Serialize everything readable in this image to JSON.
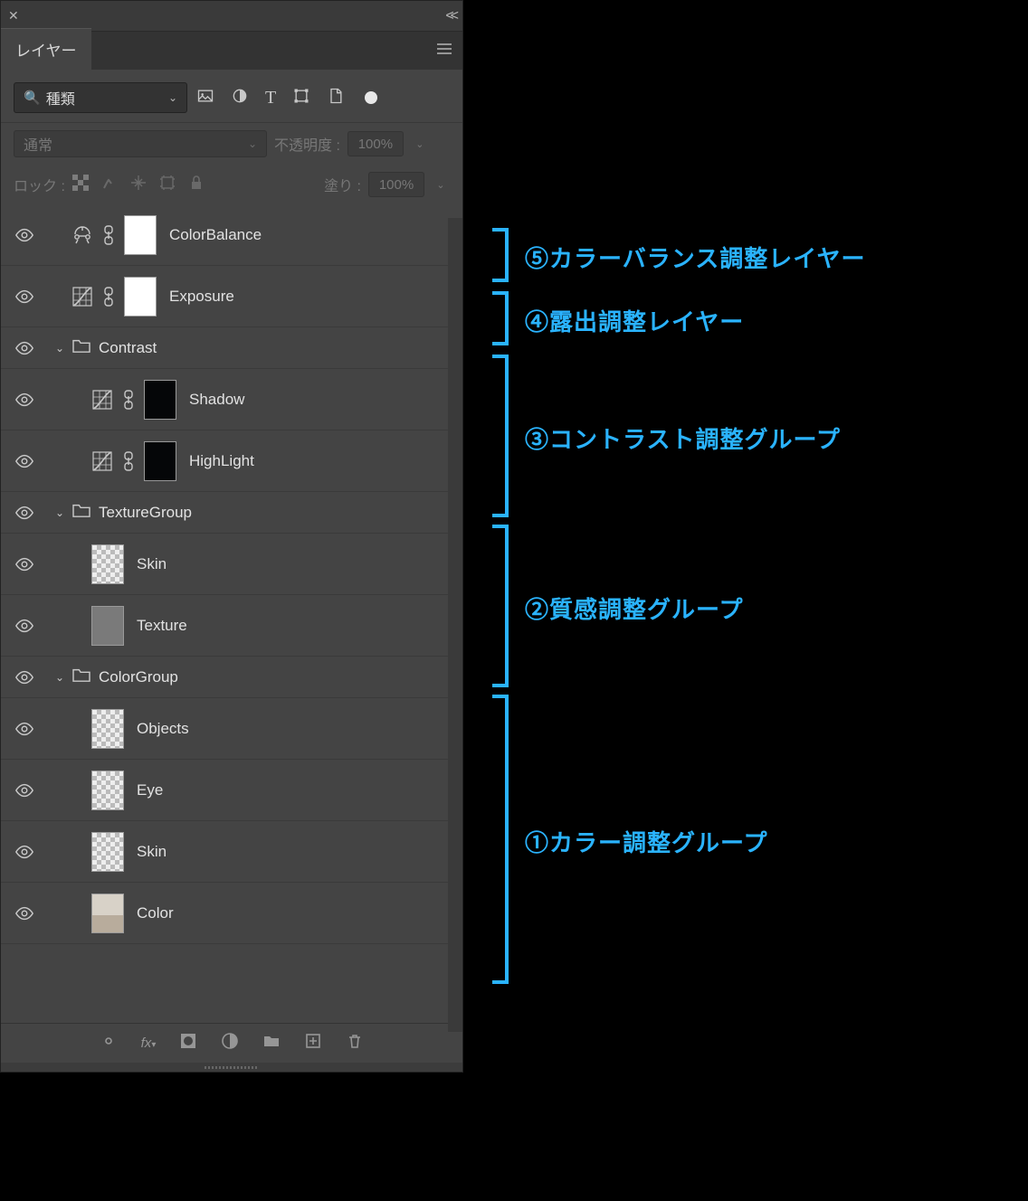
{
  "panel": {
    "tab": "レイヤー"
  },
  "filter": {
    "label": "種類"
  },
  "blend": {
    "mode": "通常",
    "opacity_label": "不透明度 :",
    "opacity": "100%"
  },
  "lock": {
    "label": "ロック :",
    "fill_label": "塗り :",
    "fill": "100%"
  },
  "layers": {
    "l1": "ColorBalance",
    "l2": "Exposure",
    "g1": "Contrast",
    "g1a": "Shadow",
    "g1b": "HighLight",
    "g2": "TextureGroup",
    "g2a": "Skin",
    "g2b": "Texture",
    "g3": "ColorGroup",
    "g3a": "Objects",
    "g3b": "Eye",
    "g3c": "Skin",
    "g3d": "Color"
  },
  "annotations": {
    "a5": "⑤カラーバランス調整レイヤー",
    "a4": "④露出調整レイヤー",
    "a3": "③コントラスト調整グループ",
    "a2": "②質感調整グループ",
    "a1": "①カラー調整グループ"
  }
}
